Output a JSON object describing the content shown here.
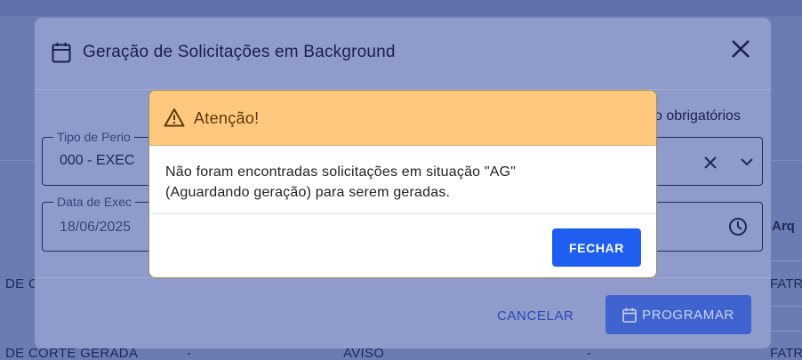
{
  "background": {
    "column_header": "Arq",
    "rows": [
      {
        "left": "DE C",
        "right": "FATR"
      },
      {
        "left": "DE CORTE GERADA",
        "mid1": "-",
        "mid2": "AVISO",
        "mid3": "-",
        "right": "FATR"
      }
    ]
  },
  "modal": {
    "title": "Geração de Solicitações em Background",
    "required_note": "o obrigatórios",
    "fields": {
      "period_type": {
        "label": "Tipo de Perio",
        "value": "000 - EXEC"
      },
      "execution_date": {
        "label": "Data de Exec",
        "value": "18/06/2025"
      }
    },
    "cancel_label": "CANCELAR",
    "program_label": "PROGRAMAR"
  },
  "alert": {
    "title": "Atenção!",
    "message_line1": "Não foram encontradas solicitações em situação \"AG\"",
    "message_line2": "(Aguardando geração) para serem geradas.",
    "close_label": "FECHAR"
  },
  "colors": {
    "alert_header": "#ffc87e",
    "primary_button": "#1f5ff0",
    "overlay": "#6b7cb3"
  }
}
